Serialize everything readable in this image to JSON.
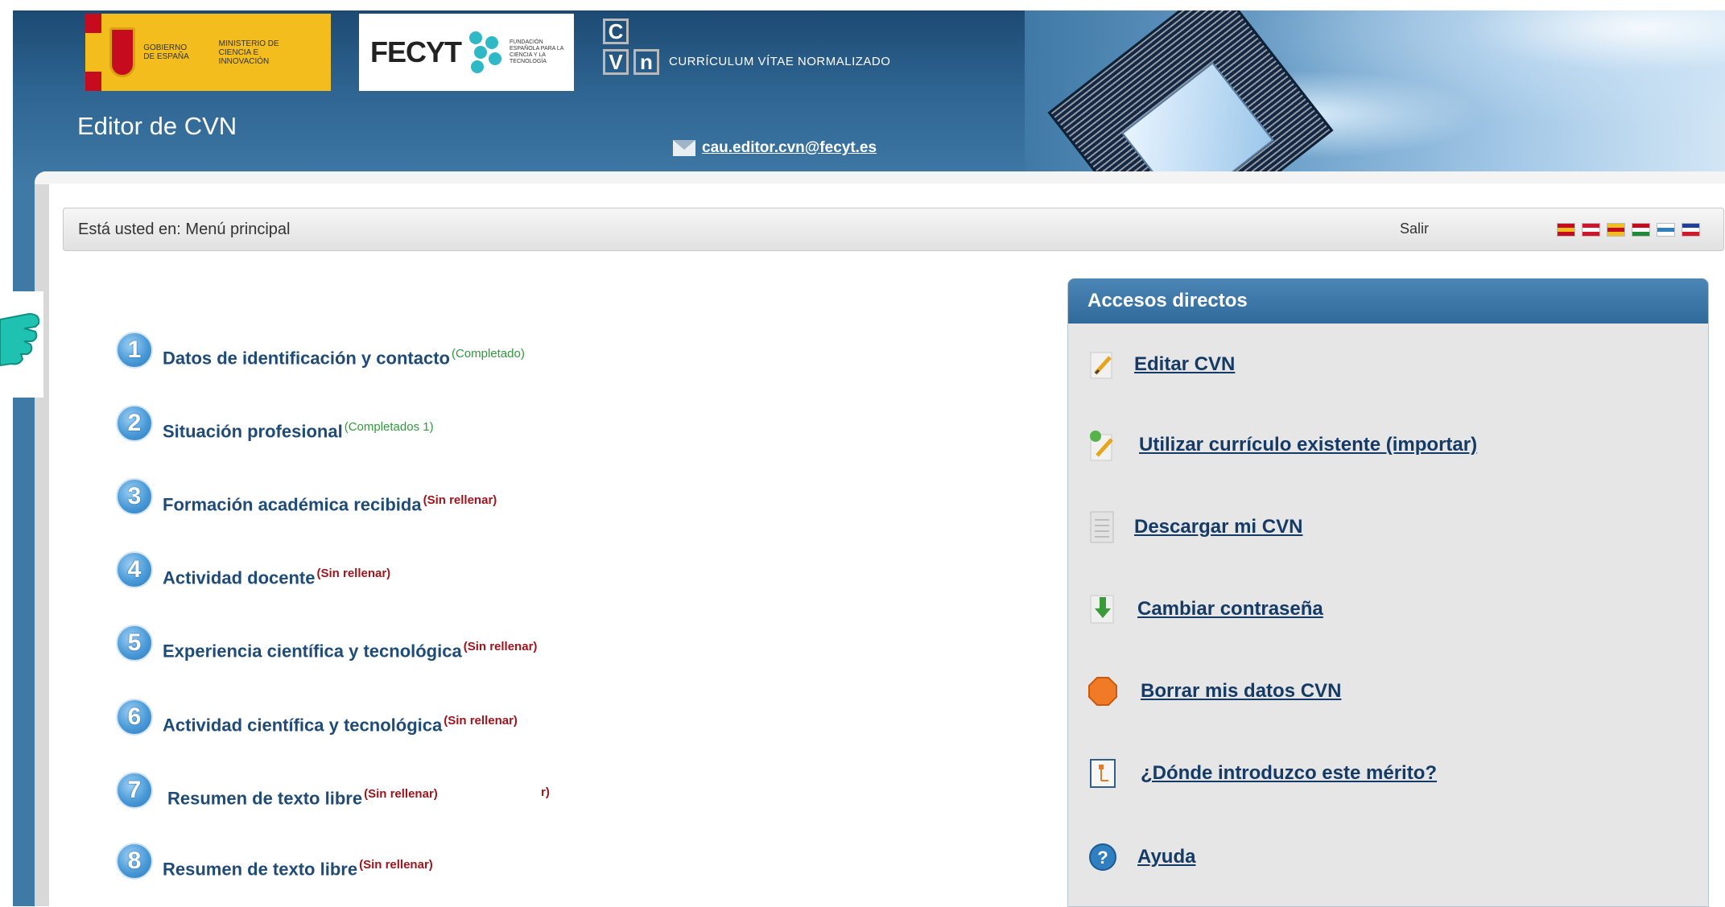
{
  "header": {
    "gov_logo_text_1": "GOBIERNO DE ESPAÑA",
    "gov_logo_text_2": "MINISTERIO DE CIENCIA E INNOVACIÓN",
    "fecyt_word": "FECYT",
    "fecyt_sub": "FUNDACIÓN ESPAÑOLA PARA LA CIENCIA Y LA TECNOLOGÍA",
    "cvn_letters": [
      "C",
      "V",
      "N"
    ],
    "cvn_tagline": "CURRÍCULUM VÍTAE NORMALIZADO",
    "app_title": "Editor de CVN",
    "contact_email": "cau.editor.cvn@fecyt.es"
  },
  "breadcrumb": {
    "text": "Está usted en: Menú principal",
    "logout_label": "Salir",
    "languages": [
      {
        "name": "es-flag-icon",
        "colors": [
          "#c60b1e",
          "#f2bd1d",
          "#c60b1e"
        ]
      },
      {
        "name": "uk-flag-icon",
        "colors": [
          "#cf142b",
          "#ffffff",
          "#cf142b"
        ]
      },
      {
        "name": "ca-flag-icon",
        "colors": [
          "#f2bd1d",
          "#c60b1e",
          "#f2bd1d"
        ]
      },
      {
        "name": "eu-flag-icon",
        "colors": [
          "#c60b1e",
          "#ffffff",
          "#1f8a3a"
        ]
      },
      {
        "name": "gl-flag-icon",
        "colors": [
          "#ffffff",
          "#2f7fc1",
          "#ffffff"
        ]
      },
      {
        "name": "fr-flag-icon",
        "colors": [
          "#1f3f9a",
          "#ffffff",
          "#d21a2b"
        ]
      }
    ]
  },
  "sections": [
    {
      "num": "1",
      "label": "Datos de identificación y contacto",
      "status": "(Completado)",
      "state": "ok"
    },
    {
      "num": "2",
      "label": "Situación profesional",
      "status": "(Completados 1)",
      "state": "ok"
    },
    {
      "num": "3",
      "label": "Formación académica recibida",
      "status": "(Sin rellenar)",
      "state": "empty"
    },
    {
      "num": "4",
      "label": "Actividad docente",
      "status": "(Sin rellenar)",
      "state": "empty"
    },
    {
      "num": "5",
      "label": "Experiencia científica y tecnológica",
      "status": "(Sin rellenar)",
      "state": "empty"
    },
    {
      "num": "6",
      "label": "Actividad científica y tecnológica",
      "status": "(Sin rellenar)",
      "state": "empty"
    },
    {
      "num": "7",
      "label": "Resumen de texto libre",
      "status": "(Sin rellenar)",
      "state": "empty"
    },
    {
      "num": "8",
      "label": "Resumen de texto libre",
      "status": "(Sin rellenar)",
      "state": "empty"
    }
  ],
  "stray_text": "r)",
  "shortcuts": {
    "title": "Accesos directos",
    "items": [
      {
        "label": "Editar CVN",
        "icon": "pencil-icon"
      },
      {
        "label": "Utilizar currículo existente (importar)",
        "icon": "import-pencil-icon"
      },
      {
        "label": "Descargar mi CVN",
        "icon": "document-icon"
      },
      {
        "label": "Cambiar contraseña",
        "icon": "download-arrow-icon"
      },
      {
        "label": "Borrar mis datos CVN",
        "icon": "stop-octagon-icon"
      },
      {
        "label": "¿Dónde introduzco este mérito?",
        "icon": "tree-document-icon"
      },
      {
        "label": "Ayuda",
        "icon": "help-icon"
      }
    ]
  },
  "colors": {
    "header_blue": "#2e6491",
    "link_blue": "#143a66",
    "status_completed": "#2f9a3c",
    "status_empty": "#a0141c",
    "pointer_hand": "#1fc2b0"
  }
}
